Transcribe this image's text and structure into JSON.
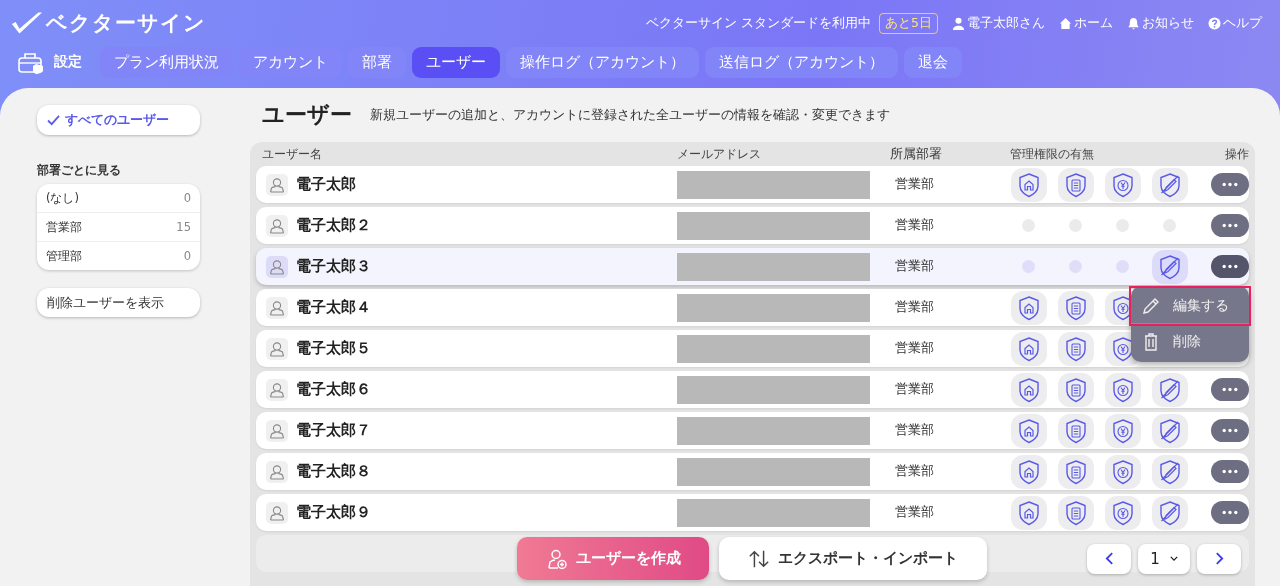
{
  "header": {
    "logo": "ベクターサイン",
    "plan": "ベクターサイン スタンダードを利用中",
    "trial_badge": "あと5日",
    "nav": [
      {
        "label": "電子太郎さん",
        "kind": "user"
      },
      {
        "label": "ホーム",
        "kind": "home"
      },
      {
        "label": "お知らせ",
        "kind": "bell"
      },
      {
        "label": "ヘルプ",
        "kind": "help"
      }
    ]
  },
  "settings_label": "設定",
  "tabs": [
    {
      "label": "プラン利用状況",
      "selected": false
    },
    {
      "label": "アカウント",
      "selected": false
    },
    {
      "label": "部署",
      "selected": false
    },
    {
      "label": "ユーザー",
      "selected": true
    },
    {
      "label": "操作ログ（アカウント）",
      "selected": false
    },
    {
      "label": "送信ログ（アカウント）",
      "selected": false
    },
    {
      "label": "退会",
      "selected": false
    }
  ],
  "sidebar": {
    "all_users": {
      "label": "すべてのユーザー",
      "selected": true
    },
    "section_title": "部署ごとに見る",
    "departments": [
      {
        "name": "(なし)",
        "count": "0"
      },
      {
        "name": "営業部",
        "count": "15"
      },
      {
        "name": "管理部",
        "count": "0"
      }
    ],
    "deleted_button": "削除ユーザーを表示"
  },
  "page": {
    "title": "ユーザー",
    "description": "新規ユーザーの追加と、アカウントに登録された全ユーザーの情報を確認・変更できます"
  },
  "table": {
    "columns": [
      "ユーザー名",
      "メールアドレス",
      "所属部署",
      "管理権限の有無",
      "操作"
    ],
    "rows": [
      {
        "name": "電子太郎",
        "department": "営業部",
        "selected": false,
        "menu_open": false,
        "permissions": [
          true,
          true,
          true,
          true
        ]
      },
      {
        "name": "電子太郎２",
        "department": "営業部",
        "selected": false,
        "menu_open": false,
        "permissions": [
          false,
          false,
          false,
          false
        ]
      },
      {
        "name": "電子太郎３",
        "department": "営業部",
        "selected": true,
        "menu_open": true,
        "permissions": [
          false,
          false,
          false,
          true
        ]
      },
      {
        "name": "電子太郎４",
        "department": "営業部",
        "selected": false,
        "permissions": [
          true,
          true,
          true
        ]
      },
      {
        "name": "電子太郎５",
        "department": "営業部",
        "selected": false,
        "permissions": [
          true,
          true,
          true
        ]
      },
      {
        "name": "電子太郎６",
        "department": "営業部",
        "selected": false,
        "menu_open": false,
        "permissions": [
          true,
          true,
          true,
          true
        ]
      },
      {
        "name": "電子太郎７",
        "department": "営業部",
        "selected": false,
        "menu_open": false,
        "permissions": [
          true,
          true,
          true,
          true
        ]
      },
      {
        "name": "電子太郎８",
        "department": "営業部",
        "selected": false,
        "menu_open": false,
        "permissions": [
          true,
          true,
          true,
          true
        ]
      },
      {
        "name": "電子太郎９",
        "department": "営業部",
        "selected": false,
        "menu_open": false,
        "permissions": [
          true,
          true,
          true,
          true
        ]
      }
    ]
  },
  "row_menu": {
    "items": [
      {
        "label": "編集する",
        "kind": "edit",
        "focused": true
      },
      {
        "label": "削除",
        "kind": "delete",
        "focused": false
      }
    ]
  },
  "footer": {
    "create": "ユーザーを作成",
    "export": "エクスポート・インポート",
    "page": "1"
  }
}
